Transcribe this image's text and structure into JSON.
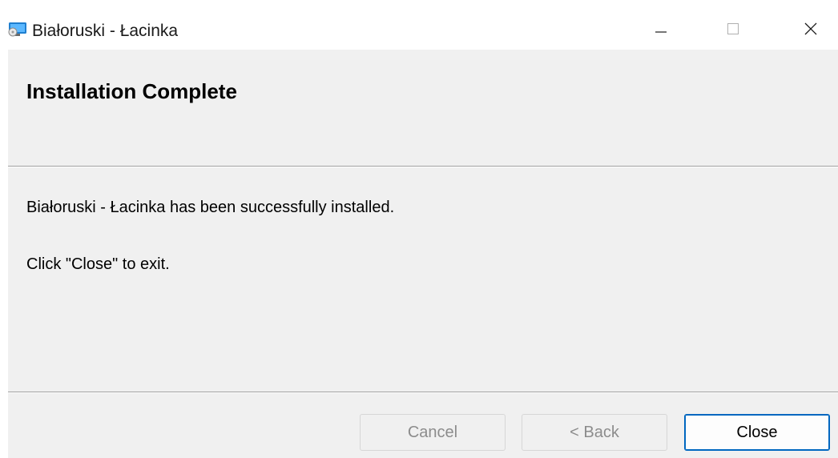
{
  "window": {
    "title": "Białoruski - Łacinka",
    "icon": "installer-monitor-icon",
    "controls": [
      "minimize-icon",
      "maximize-icon",
      "close-icon"
    ]
  },
  "header": {
    "title": "Installation Complete"
  },
  "body": {
    "message": "Białoruski - Łacinka has been successfully installed.",
    "hint": "Click \"Close\" to exit."
  },
  "buttons": {
    "cancel": "Cancel",
    "back": "< Back",
    "close": "Close"
  },
  "colors": {
    "panel_bg": "#f0f0f0",
    "accent": "#0067c0",
    "disabled_text": "#8c8c8c"
  }
}
